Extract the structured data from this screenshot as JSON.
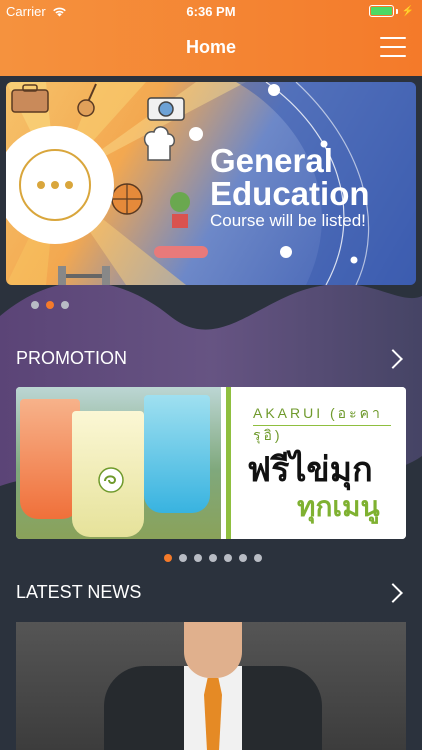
{
  "status_bar": {
    "carrier": "Carrier",
    "time": "6:36 PM"
  },
  "nav": {
    "title": "Home",
    "menu_icon": "hamburger-menu-icon"
  },
  "banner": {
    "title_line1": "General",
    "title_line2": "Education",
    "subtitle": "Course will be listed!",
    "page_count": 3,
    "active_page": 2
  },
  "promotion": {
    "title": "PROMOTION",
    "brand": "AKARUI (อะคารุอิ)",
    "line1": "ฟรีไข่มุก",
    "line2": "ทุกเมนู",
    "page_count": 7,
    "active_page": 1
  },
  "latest_news": {
    "title": "LATEST NEWS"
  },
  "colors": {
    "header_orange": "#f47a2a",
    "background": "#2b323d",
    "accent_green": "#8fbf3f"
  }
}
